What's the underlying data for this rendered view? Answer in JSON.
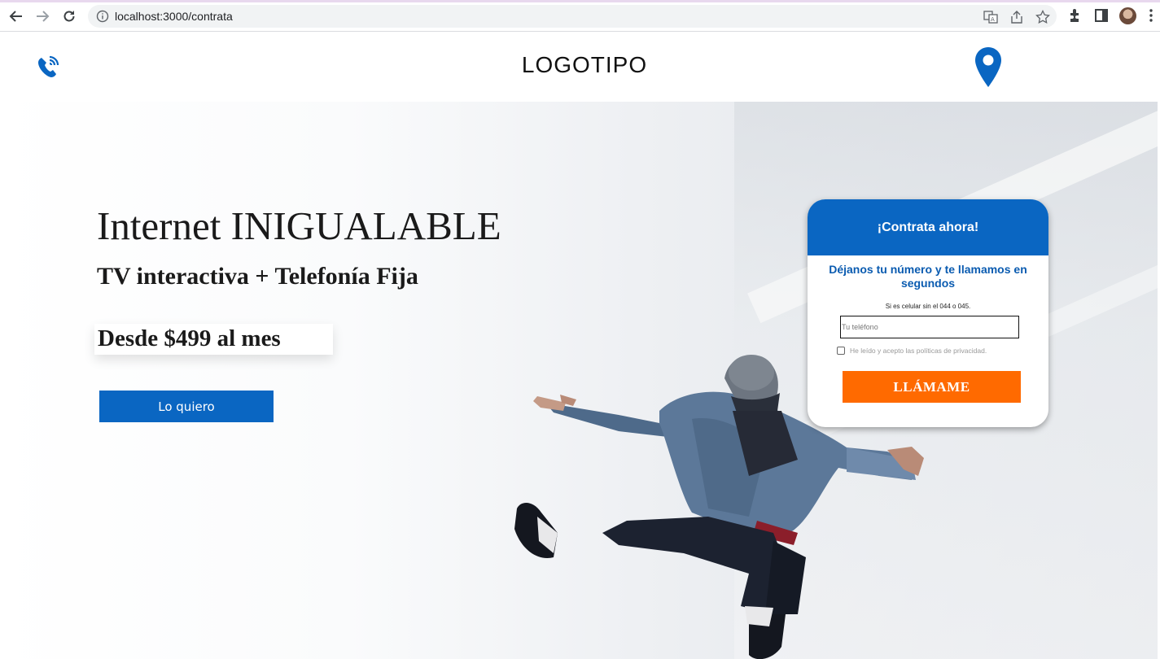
{
  "browser": {
    "url": "localhost:3000/contrata"
  },
  "header": {
    "logo": "LOGOTIPO"
  },
  "hero": {
    "headline": "Internet INIGUALABLE",
    "subhead": "TV interactiva + Telefonía Fija",
    "price": "Desde $499 al mes",
    "cta_label": "Lo quiero"
  },
  "form": {
    "title": "¡Contrata ahora!",
    "subtitle": "Déjanos tu número y te llamamos en segundos",
    "hint": "Si es celular sin el 044 o 045.",
    "phone_placeholder": "Tu teléfono",
    "privacy_label": "He leído y acepto las políticas de privacidad.",
    "submit_label": "LLÁMAME"
  },
  "colors": {
    "brand_blue": "#0a66c2",
    "orange": "#ff6a00"
  },
  "icons": [
    "back-arrow-icon",
    "forward-arrow-icon",
    "reload-icon",
    "info-icon",
    "translate-icon",
    "share-icon",
    "star-icon",
    "extensions-icon",
    "sidepanel-icon",
    "menu-icon",
    "phone-icon",
    "location-pin-icon"
  ]
}
